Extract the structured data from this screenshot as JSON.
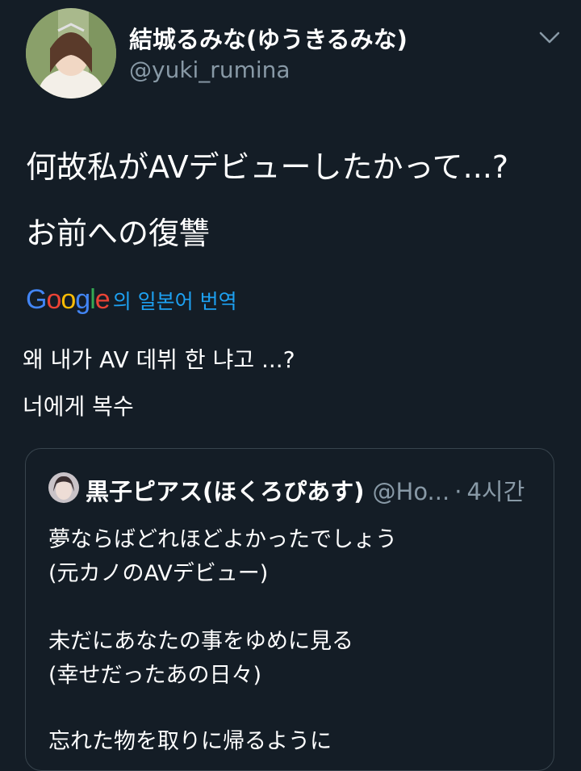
{
  "author": {
    "name": "結城るみな(ゆうきるみな)",
    "handle": "@yuki_rumina"
  },
  "tweet": {
    "lines": [
      "何故私がAVデビューしたかって...?",
      "お前への復讐"
    ]
  },
  "translation": {
    "google_logo": [
      "G",
      "o",
      "o",
      "g",
      "l",
      "e"
    ],
    "label": "의 일본어 번역",
    "lines": [
      "왜 내가 AV 데뷔 한 냐고 ...?",
      "너에게 복수"
    ]
  },
  "quoted": {
    "name": "黒子ピアス(ほくろぴあす)",
    "handle": "@Ho...",
    "separator": "·",
    "time": "4시간",
    "lines": [
      "夢ならばどれほどよかったでしょう",
      "(元カノのAVデビュー)",
      "未だにあなたの事をゆめに見る",
      "(幸せだったあの日々)",
      "忘れた物を取りに帰るように"
    ]
  },
  "colors": {
    "background": "#141d26",
    "secondary_text": "#8899a6",
    "link": "#1da1f2",
    "border": "#38444d",
    "google": [
      "#4285f4",
      "#ea4335",
      "#fbbc05",
      "#4285f4",
      "#34a853",
      "#ea4335"
    ]
  },
  "icons": {
    "more": "chevron-down-icon",
    "avatar": "user-avatar-photo",
    "quoted_avatar": "quoted-user-avatar-photo"
  }
}
